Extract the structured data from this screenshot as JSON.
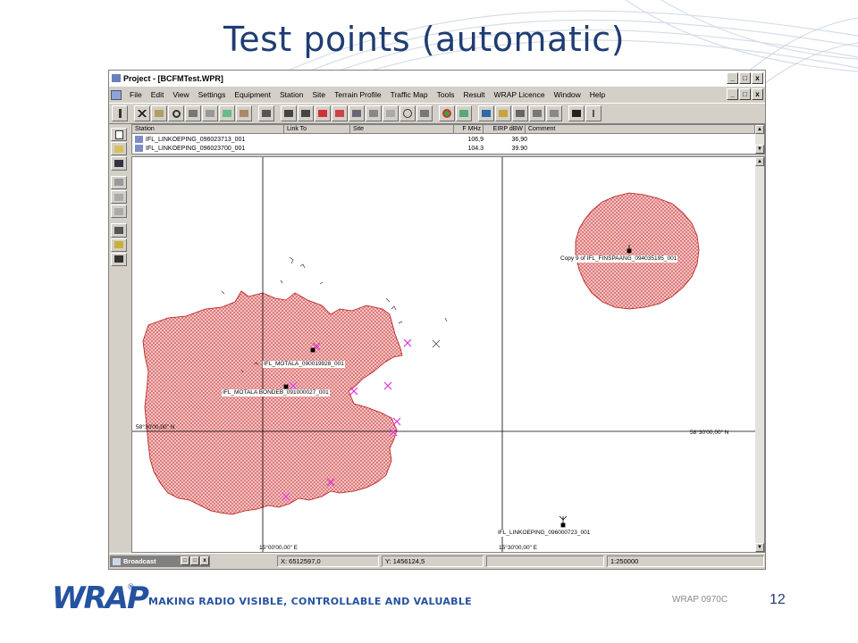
{
  "slide": {
    "title": "Test points (automatic)",
    "footer_code": "WRAP 0970C",
    "page_number": "12",
    "logo_text": "WRAP",
    "logo_mark": "®",
    "tagline": "MAKING RADIO VISIBLE, CONTROLLABLE AND VALUABLE",
    "brand_color": "#2552a0"
  },
  "window": {
    "title": "Project - [BCFMTest.WPR]",
    "minimize": "_",
    "maximize": "□",
    "close": "x"
  },
  "menu": [
    "File",
    "Edit",
    "View",
    "Settings",
    "Equipment",
    "Station",
    "Site",
    "Terrain Profile",
    "Traffic Map",
    "Tools",
    "Result",
    "WRAP Licence",
    "Window",
    "Help"
  ],
  "station_list": {
    "columns": [
      "Station",
      "Link To",
      "Site",
      "F MHz",
      "EIRP dBW",
      "Comment"
    ],
    "rows": [
      {
        "station": "IFL_LINKOEPING_096023713_001",
        "link_to": "",
        "site": "",
        "f_mhz": "106,9",
        "eirp": "36,90",
        "comment": ""
      },
      {
        "station": "IFL_LINKOEPING_096023700_001",
        "link_to": "",
        "site": "",
        "f_mhz": "104.3",
        "eirp": "39.90",
        "comment": ""
      }
    ]
  },
  "map": {
    "coverage_color": "#e07a7a",
    "coverage_edge": "#b81818",
    "test_point_color": "#e030e0",
    "labels": {
      "finspaang": "Copy 9 of IFL_FINSPAANG_094035195_001",
      "motala1": "IFL_MOTALA_090019928_001",
      "motala2": "IFL_MOTALA BONDEB_091000027_001",
      "linkoeping": "IFL_LINKOEPING_096000723_001"
    },
    "coords": {
      "lat_left": "58°30'00,00\" N",
      "lat_right": "58°30'00,00\" N",
      "lon_left": "15°00'00,00\" E",
      "lon_right": "15°30'00,00\" E"
    }
  },
  "statusbar": {
    "task_label": "Broadcast",
    "x": "X: 6512597,0",
    "y": "Y: 1456124,5",
    "scale": "1:250000"
  }
}
